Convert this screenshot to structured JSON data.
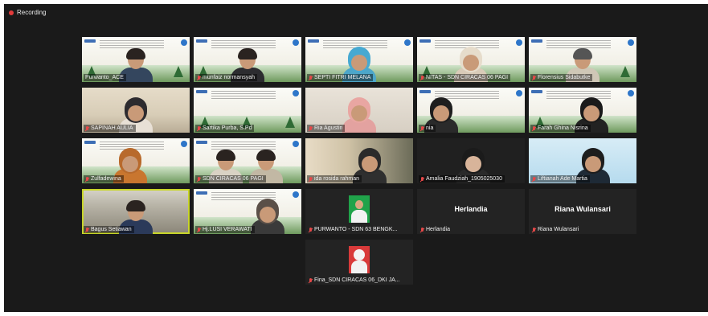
{
  "recording": {
    "label": "Recording",
    "indicator_color": "#e23b3b"
  },
  "active_speaker_border": "#c8d52a",
  "participants": [
    {
      "name": "Purwanto_ACE",
      "muted": true,
      "video": "slide"
    },
    {
      "name": "munfaiz normansyah",
      "muted": true,
      "video": "slide"
    },
    {
      "name": "SEPTI FITRI MELANA",
      "muted": true,
      "video": "slide"
    },
    {
      "name": "NITAS - SDN CIRACAS 06 PAGI",
      "muted": true,
      "video": "slide"
    },
    {
      "name": "Florensius Sidabutke",
      "muted": true,
      "video": "slide"
    },
    {
      "name": "SAPINAH AULIA",
      "muted": true,
      "video": "room"
    },
    {
      "name": "Sartika Purba, S.Pd",
      "muted": true,
      "video": "slide"
    },
    {
      "name": "Ria Agustin",
      "muted": true,
      "video": "room"
    },
    {
      "name": "nia",
      "muted": true,
      "video": "slide"
    },
    {
      "name": "Farah Ghina Nisrina",
      "muted": true,
      "video": "slide"
    },
    {
      "name": "Zulfadewina",
      "muted": true,
      "video": "slide"
    },
    {
      "name": "SDN CIRACAS 06 PAGI",
      "muted": true,
      "video": "slide"
    },
    {
      "name": "ida rosida rahman",
      "muted": true,
      "video": "room"
    },
    {
      "name": "Amalia Faudziah_1905025030",
      "muted": true,
      "video": "blue"
    },
    {
      "name": "Liftianah Ade Martia",
      "muted": true,
      "video": "blue"
    },
    {
      "name": "Bagus Setiawan",
      "muted": true,
      "video": "room",
      "active": true
    },
    {
      "name": "Hj.LUSI VERAWATI",
      "muted": true,
      "video": "slide"
    },
    {
      "name": "PURWANTO - SDN 63 BENGK...",
      "muted": true,
      "video": "avatar-green"
    },
    {
      "name": "Herlandia",
      "muted": true,
      "video": "off",
      "display": "Herlandia"
    },
    {
      "name": "Riana Wulansari",
      "muted": true,
      "video": "off",
      "display": "Riana Wulansari"
    },
    {
      "name": "Fina_SDN CIRACAS 06_DKI JA...",
      "muted": true,
      "video": "avatar-red"
    }
  ]
}
